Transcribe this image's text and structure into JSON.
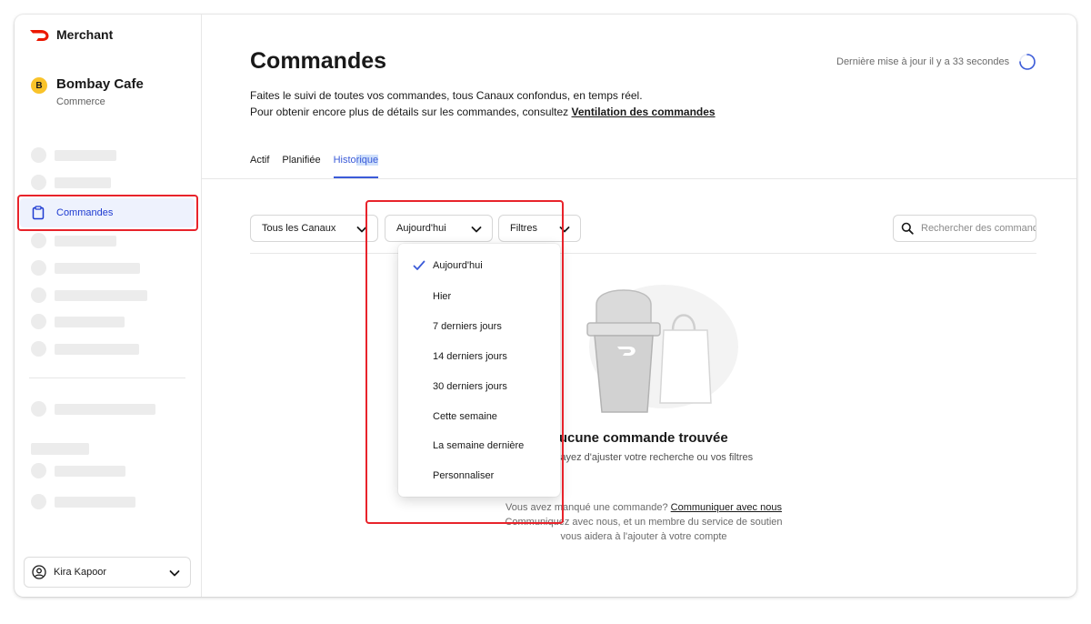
{
  "brand": {
    "name": "Merchant",
    "accent": "#eb1700"
  },
  "store": {
    "initial": "B",
    "name": "Bombay Cafe",
    "type": "Commerce"
  },
  "sidebar": {
    "active_item": "Commandes"
  },
  "user": {
    "name": "Kira Kapoor"
  },
  "page": {
    "title": "Commandes",
    "last_update": "Dernière mise à jour il y a 33 secondes",
    "subtitle_line1": "Faites le suivi de toutes vos commandes, tous Canaux confondus, en temps réel.",
    "subtitle_line2": "Pour obtenir encore plus de détails sur les commandes, consultez ",
    "subtitle_link": "Ventilation des commandes"
  },
  "tabs": {
    "actif": "Actif",
    "planifiee": "Planifiée",
    "historique_a": "Histo",
    "historique_b": "rique"
  },
  "filters": {
    "channels": "Tous les Canaux",
    "date": "Aujourd'hui",
    "filters": "Filtres",
    "search_placeholder": "Rechercher des commandes"
  },
  "date_menu": {
    "selected": "Aujourd'hui",
    "options": [
      "Aujourd'hui",
      "Hier",
      "7 derniers jours",
      "14 derniers jours",
      "30 derniers jours",
      "Cette semaine",
      "La semaine dernière",
      "Personnaliser"
    ]
  },
  "empty_state": {
    "title": "Aucune commande trouvée",
    "subtitle": "Essayez d'ajuster votre recherche ou vos filtres",
    "help_prefix": "Vous avez manqué une commande? ",
    "help_link": "Communiquer avec nous",
    "help_suffix": " Communiquez avec nous, et un membre du service de soutien vous aidera à l'ajouter à votre compte"
  },
  "colors": {
    "accent_blue": "#3b5bd8",
    "annotation_red": "#e8232b"
  }
}
